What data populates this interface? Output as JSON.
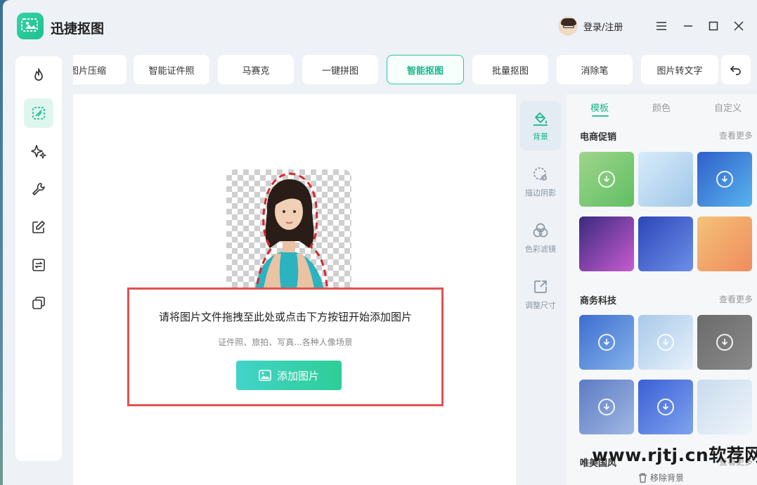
{
  "app": {
    "title": "迅捷抠图",
    "login_label": "登录/注册",
    "window_controls": [
      "menu-icon",
      "minimize-icon",
      "maximize-icon",
      "close-icon"
    ]
  },
  "left_rail": {
    "items": [
      {
        "icon": "fire-icon",
        "active": false
      },
      {
        "icon": "cutout-icon",
        "active": true
      },
      {
        "icon": "sparkle-icon",
        "active": false
      },
      {
        "icon": "wrench-icon",
        "active": false
      },
      {
        "icon": "edit-icon",
        "active": false
      },
      {
        "icon": "convert-icon",
        "active": false
      },
      {
        "icon": "layers-icon",
        "active": false
      }
    ]
  },
  "tabs": [
    {
      "label": "图片压缩"
    },
    {
      "label": "智能证件照"
    },
    {
      "label": "马赛克"
    },
    {
      "label": "一键拼图"
    },
    {
      "label": "智能抠图",
      "active": true
    },
    {
      "label": "批量抠图"
    },
    {
      "label": "消除笔"
    },
    {
      "label": "图片转文字"
    }
  ],
  "canvas": {
    "drop_title": "请将图片文件拖拽至此处或点击下方按钮开始添加图片",
    "drop_subtitle": "证件照、旅拍、写真...各种人像场景",
    "add_button": "添加图片"
  },
  "tool_column": [
    {
      "label": "背景",
      "icon": "paint-bucket-icon",
      "active": true
    },
    {
      "label": "描边阴影",
      "icon": "stroke-shadow-icon",
      "active": false
    },
    {
      "label": "色彩滤镜",
      "icon": "color-filter-icon",
      "active": false
    },
    {
      "label": "调整尺寸",
      "icon": "resize-icon",
      "active": false
    }
  ],
  "right_panel": {
    "tabs": [
      {
        "label": "模板",
        "active": true
      },
      {
        "label": "颜色",
        "active": false
      },
      {
        "label": "自定义",
        "active": false
      }
    ],
    "sections": [
      {
        "title": "电商促销",
        "more": "查看更多",
        "thumbs": [
          {
            "colors": [
              "#9fd58b",
              "#5fbf63"
            ],
            "download": true
          },
          {
            "colors": [
              "#d9ecfa",
              "#9fc6e8"
            ],
            "download": false
          },
          {
            "colors": [
              "#2f5fc9",
              "#58b4ef"
            ],
            "download": true
          },
          {
            "colors": [
              "#3a2a80",
              "#c85bd0"
            ],
            "download": false
          },
          {
            "colors": [
              "#2d46b8",
              "#6c8fe8"
            ],
            "download": false
          },
          {
            "colors": [
              "#f4c278",
              "#f08c5d"
            ],
            "download": false
          }
        ]
      },
      {
        "title": "商务科技",
        "more": "查看更多",
        "thumbs": [
          {
            "colors": [
              "#3d6ed0",
              "#85b2ea"
            ],
            "download": true
          },
          {
            "colors": [
              "#a9c8ea",
              "#e7f2fb"
            ],
            "download": true
          },
          {
            "colors": [
              "#6b6b6b",
              "#8a8a8a"
            ],
            "download": true
          },
          {
            "colors": [
              "#5d7bc4",
              "#9fb8e3"
            ],
            "download": true
          },
          {
            "colors": [
              "#3c5fd6",
              "#7ea4ee"
            ],
            "download": true
          },
          {
            "colors": [
              "#c9dbee",
              "#eef4fa"
            ],
            "download": false
          }
        ]
      },
      {
        "title": "唯美国风",
        "more": "查看更多",
        "thumbs": []
      }
    ],
    "remove_bg": "移除背景"
  },
  "watermark": "www.rjtj.cn软荐网"
}
